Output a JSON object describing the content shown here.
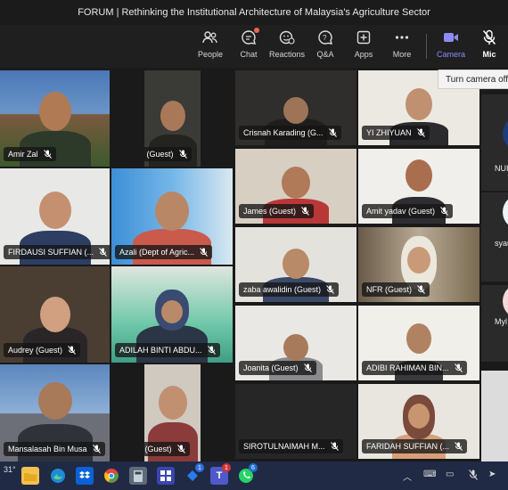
{
  "window": {
    "title": "FORUM | Rethinking the Institutional Architecture of Malaysia's Agriculture Sector"
  },
  "toolbar": {
    "buttons": [
      {
        "label": "People",
        "icon": "people-icon"
      },
      {
        "label": "Chat",
        "icon": "chat-icon"
      },
      {
        "label": "Reactions",
        "icon": "reactions-icon"
      },
      {
        "label": "Q&A",
        "icon": "qa-icon"
      },
      {
        "label": "Apps",
        "icon": "apps-icon"
      },
      {
        "label": "More",
        "icon": "more-icon"
      },
      {
        "label": "Camera",
        "icon": "camera-icon"
      },
      {
        "label": "Mic",
        "icon": "mic-off-icon"
      }
    ],
    "tooltip": "Turn camera off (",
    "accent": "#8b8cf5"
  },
  "participants": [
    {
      "name": "Amir Zal",
      "muted": true
    },
    {
      "name": "Zamir (Guest)",
      "muted": true
    },
    {
      "name": "FIRDAUSI SUFFIAN (...",
      "muted": true
    },
    {
      "name": "Azali (Dept of Agric...",
      "muted": true
    },
    {
      "name": "Audrey (Guest)",
      "muted": true
    },
    {
      "name": "ADILAH BINTI ABDU...",
      "muted": true
    },
    {
      "name": "Mansalasah Bin Musa",
      "muted": true
    },
    {
      "name": "jakim (Guest)",
      "muted": true
    },
    {
      "name": "Crisnah Karading (G...",
      "muted": true
    },
    {
      "name": "YI ZHIYUAN",
      "muted": true
    },
    {
      "name": "James (Guest)",
      "muted": true
    },
    {
      "name": "Amit yadav (Guest)",
      "muted": true
    },
    {
      "name": "zaba awalidin (Guest)",
      "muted": true
    },
    {
      "name": "NFR (Guest)",
      "muted": true
    },
    {
      "name": "Joanita (Guest)",
      "muted": true
    },
    {
      "name": "ADIBI RAHIMAN BIN...",
      "muted": true
    },
    {
      "name": "SIROTULNAIMAH M...",
      "muted": true
    },
    {
      "name": "FARIDAH SUFFIAN (...",
      "muted": true
    }
  ],
  "sidebar": {
    "items": [
      {
        "label": "NUI"
      },
      {
        "label": "syar"
      },
      {
        "label": "Myl"
      }
    ]
  },
  "taskbar": {
    "weather": "31°",
    "badges": {
      "jira": "1",
      "teams": "1",
      "whatsapp": "6"
    }
  }
}
